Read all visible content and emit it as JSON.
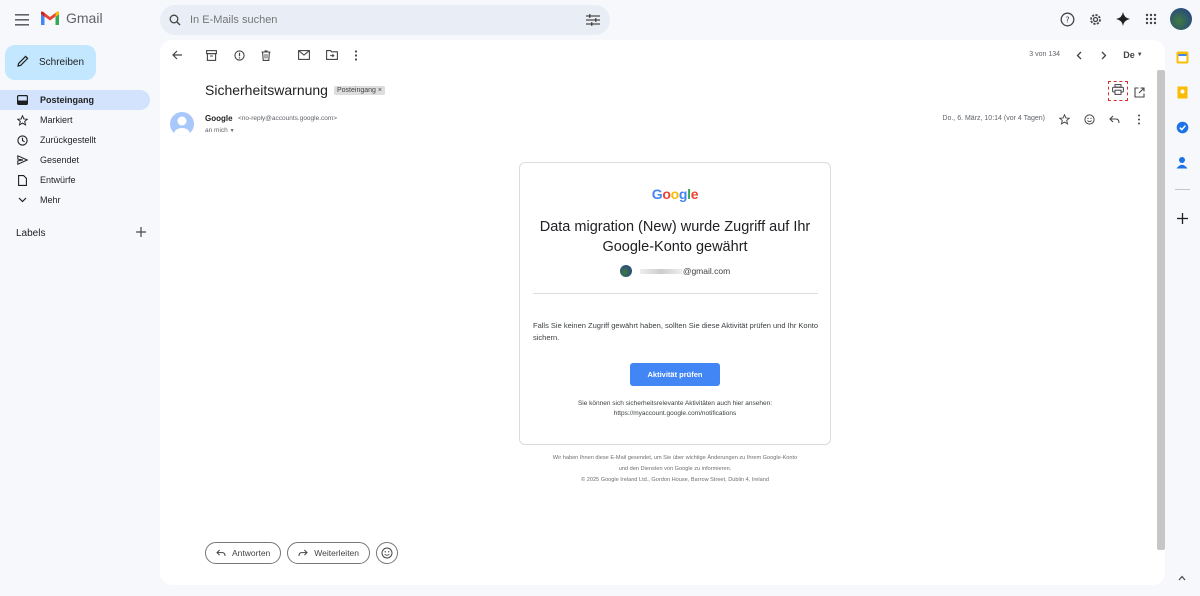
{
  "app": {
    "name": "Gmail"
  },
  "search": {
    "placeholder": "In E-Mails suchen"
  },
  "compose": {
    "label": "Schreiben"
  },
  "sidebar": {
    "items": [
      {
        "label": "Posteingang",
        "icon": "inbox-icon",
        "active": true
      },
      {
        "label": "Markiert",
        "icon": "star-icon"
      },
      {
        "label": "Zurückgestellt",
        "icon": "clock-icon"
      },
      {
        "label": "Gesendet",
        "icon": "send-icon"
      },
      {
        "label": "Entwürfe",
        "icon": "draft-icon"
      },
      {
        "label": "Mehr",
        "icon": "chevron-down-icon"
      }
    ],
    "labels_heading": "Labels"
  },
  "toolbar": {
    "pager": "3 von 134",
    "language": "De"
  },
  "email": {
    "subject": "Sicherheitswarnung",
    "label_badge": "Posteingang",
    "label_badge_close": "×",
    "sender_name": "Google",
    "sender_address": "<no-reply@accounts.google.com>",
    "recipient": "an mich",
    "date": "Do., 6. März, 10:14 (vor 4 Tagen)"
  },
  "card": {
    "logo": "Google",
    "title": "Data migration (New) wurde Zugriff auf Ihr Google-Konto gewährt",
    "account_suffix": "@gmail.com",
    "body": "Falls Sie keinen Zugriff gewährt haben, sollten Sie diese Aktivität prüfen und Ihr Konto sichern.",
    "button": "Aktivität prüfen",
    "footer_line1": "Sie können sich sicherheitsrelevante Aktivitäten auch hier ansehen:",
    "footer_line2": "https://myaccount.google.com/notifications"
  },
  "legal": {
    "line1": "Wir haben Ihnen diese E-Mail gesendet, um Sie über wichtige Änderungen zu Ihrem Google-Konto",
    "line2": "und den Diensten von Google zu informieren.",
    "line3": "© 2025 Google Ireland Ltd., Gordon House, Barrow Street, Dublin 4, Ireland"
  },
  "actions": {
    "reply": "Antworten",
    "forward": "Weiterleiten"
  },
  "colors": {
    "accent": "#4285f4",
    "compose_bg": "#c2e7ff",
    "active_nav": "#d3e3fd",
    "highlight": "#d93025"
  }
}
